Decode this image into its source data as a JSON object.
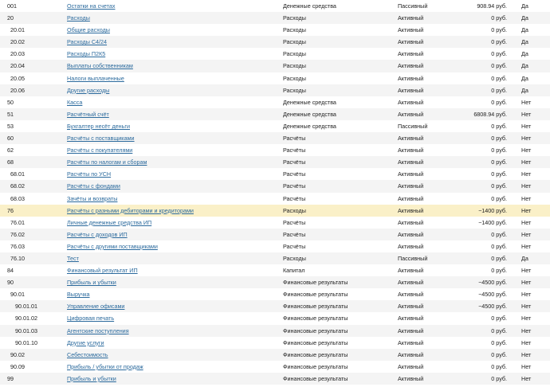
{
  "colors": {
    "link": "#2b6a9d",
    "selected_row": "#faf0c8",
    "alt_row": "#f4f4f4"
  },
  "rows": [
    {
      "code": "001",
      "name": "Остатки на счетах",
      "type": "Денежные средства",
      "kind": "Пассивный",
      "balance": "908.94 руб.",
      "flag": "Да",
      "level": 0,
      "selected": false
    },
    {
      "code": "20",
      "name": "Расходы",
      "type": "Расходы",
      "kind": "Активный",
      "balance": "0 руб.",
      "flag": "Да",
      "level": 0,
      "selected": false
    },
    {
      "code": "20.01",
      "name": "Общие расходы",
      "type": "Расходы",
      "kind": "Активный",
      "balance": "0 руб.",
      "flag": "Да",
      "level": 1,
      "selected": false
    },
    {
      "code": "20.02",
      "name": "Расходы С4/24",
      "type": "Расходы",
      "kind": "Активный",
      "balance": "0 руб.",
      "flag": "Да",
      "level": 1,
      "selected": false
    },
    {
      "code": "20.03",
      "name": "Расходы П2К5",
      "type": "Расходы",
      "kind": "Активный",
      "balance": "0 руб.",
      "flag": "Да",
      "level": 1,
      "selected": false
    },
    {
      "code": "20.04",
      "name": "Выплаты собственникам",
      "type": "Расходы",
      "kind": "Активный",
      "balance": "0 руб.",
      "flag": "Да",
      "level": 1,
      "selected": false
    },
    {
      "code": "20.05",
      "name": "Налоги выплаченные",
      "type": "Расходы",
      "kind": "Активный",
      "balance": "0 руб.",
      "flag": "Да",
      "level": 1,
      "selected": false
    },
    {
      "code": "20.06",
      "name": "Другие расходы",
      "type": "Расходы",
      "kind": "Активный",
      "balance": "0 руб.",
      "flag": "Да",
      "level": 1,
      "selected": false
    },
    {
      "code": "50",
      "name": "Касса",
      "type": "Денежные средства",
      "kind": "Активный",
      "balance": "0 руб.",
      "flag": "Нет",
      "level": 0,
      "selected": false
    },
    {
      "code": "51",
      "name": "Расчётный счёт",
      "type": "Денежные средства",
      "kind": "Активный",
      "balance": "6808.94 руб.",
      "flag": "Нет",
      "level": 0,
      "selected": false
    },
    {
      "code": "53",
      "name": "Бухгалтер несёт деньги",
      "type": "Денежные средства",
      "kind": "Пассивный",
      "balance": "0 руб.",
      "flag": "Нет",
      "level": 0,
      "selected": false
    },
    {
      "code": "60",
      "name": "Расчёты с поставщиками",
      "type": "Расчёты",
      "kind": "Активный",
      "balance": "0 руб.",
      "flag": "Нет",
      "level": 0,
      "selected": false
    },
    {
      "code": "62",
      "name": "Расчёты с покупателями",
      "type": "Расчёты",
      "kind": "Активный",
      "balance": "0 руб.",
      "flag": "Нет",
      "level": 0,
      "selected": false
    },
    {
      "code": "68",
      "name": "Расчёты по налогам и сборам",
      "type": "Расчёты",
      "kind": "Активный",
      "balance": "0 руб.",
      "flag": "Нет",
      "level": 0,
      "selected": false
    },
    {
      "code": "68.01",
      "name": "Расчёты по УСН",
      "type": "Расчёты",
      "kind": "Активный",
      "balance": "0 руб.",
      "flag": "Нет",
      "level": 1,
      "selected": false
    },
    {
      "code": "68.02",
      "name": "Расчёты с фондами",
      "type": "Расчёты",
      "kind": "Активный",
      "balance": "0 руб.",
      "flag": "Нет",
      "level": 1,
      "selected": false
    },
    {
      "code": "68.03",
      "name": "Зачёты и возвраты",
      "type": "Расчёты",
      "kind": "Активный",
      "balance": "0 руб.",
      "flag": "Нет",
      "level": 1,
      "selected": false
    },
    {
      "code": "76",
      "name": "Расчёты с разными дебиторами и кредиторами",
      "type": "Расходы",
      "kind": "Активный",
      "balance": "−1400 руб.",
      "flag": "Нет",
      "level": 0,
      "selected": true
    },
    {
      "code": "76.01",
      "name": "Личные денежные средства ИП",
      "type": "Расчёты",
      "kind": "Активный",
      "balance": "−1400 руб.",
      "flag": "Нет",
      "level": 1,
      "selected": false
    },
    {
      "code": "76.02",
      "name": "Расчёты с доходов ИП",
      "type": "Расчёты",
      "kind": "Активный",
      "balance": "0 руб.",
      "flag": "Нет",
      "level": 1,
      "selected": false
    },
    {
      "code": "76.03",
      "name": "Расчёты с другими поставщиками",
      "type": "Расчёты",
      "kind": "Активный",
      "balance": "0 руб.",
      "flag": "Нет",
      "level": 1,
      "selected": false
    },
    {
      "code": "76.10",
      "name": "Тест",
      "type": "Расходы",
      "kind": "Пассивный",
      "balance": "0 руб.",
      "flag": "Да",
      "level": 1,
      "selected": false
    },
    {
      "code": "84",
      "name": "Финансовый результат ИП",
      "type": "Капитал",
      "kind": "Активный",
      "balance": "0 руб.",
      "flag": "Нет",
      "level": 0,
      "selected": false
    },
    {
      "code": "90",
      "name": "Прибыль и убытки",
      "type": "Финансовые результаты",
      "kind": "Активный",
      "balance": "−4500 руб.",
      "flag": "Нет",
      "level": 0,
      "selected": false
    },
    {
      "code": "90.01",
      "name": "Выручка",
      "type": "Финансовые результаты",
      "kind": "Активный",
      "balance": "−4500 руб.",
      "flag": "Нет",
      "level": 1,
      "selected": false
    },
    {
      "code": "90.01.01",
      "name": "Управление офисами",
      "type": "Финансовые результаты",
      "kind": "Активный",
      "balance": "−4500 руб.",
      "flag": "Нет",
      "level": 2,
      "selected": false
    },
    {
      "code": "90.01.02",
      "name": "Цифровая печать",
      "type": "Финансовые результаты",
      "kind": "Активный",
      "balance": "0 руб.",
      "flag": "Нет",
      "level": 2,
      "selected": false
    },
    {
      "code": "90.01.03",
      "name": "Агентские поступления",
      "type": "Финансовые результаты",
      "kind": "Активный",
      "balance": "0 руб.",
      "flag": "Нет",
      "level": 2,
      "selected": false
    },
    {
      "code": "90.01.10",
      "name": "Другие услуги",
      "type": "Финансовые результаты",
      "kind": "Активный",
      "balance": "0 руб.",
      "flag": "Нет",
      "level": 2,
      "selected": false
    },
    {
      "code": "90.02",
      "name": "Себестоимость",
      "type": "Финансовые результаты",
      "kind": "Активный",
      "balance": "0 руб.",
      "flag": "Нет",
      "level": 1,
      "selected": false
    },
    {
      "code": "90.09",
      "name": "Прибыль / убытки от продаж",
      "type": "Финансовые результаты",
      "kind": "Активный",
      "balance": "0 руб.",
      "flag": "Нет",
      "level": 1,
      "selected": false
    },
    {
      "code": "99",
      "name": "Прибыль и убытки",
      "type": "Финансовые результаты",
      "kind": "Активный",
      "balance": "0 руб.",
      "flag": "Нет",
      "level": 0,
      "selected": false
    }
  ]
}
